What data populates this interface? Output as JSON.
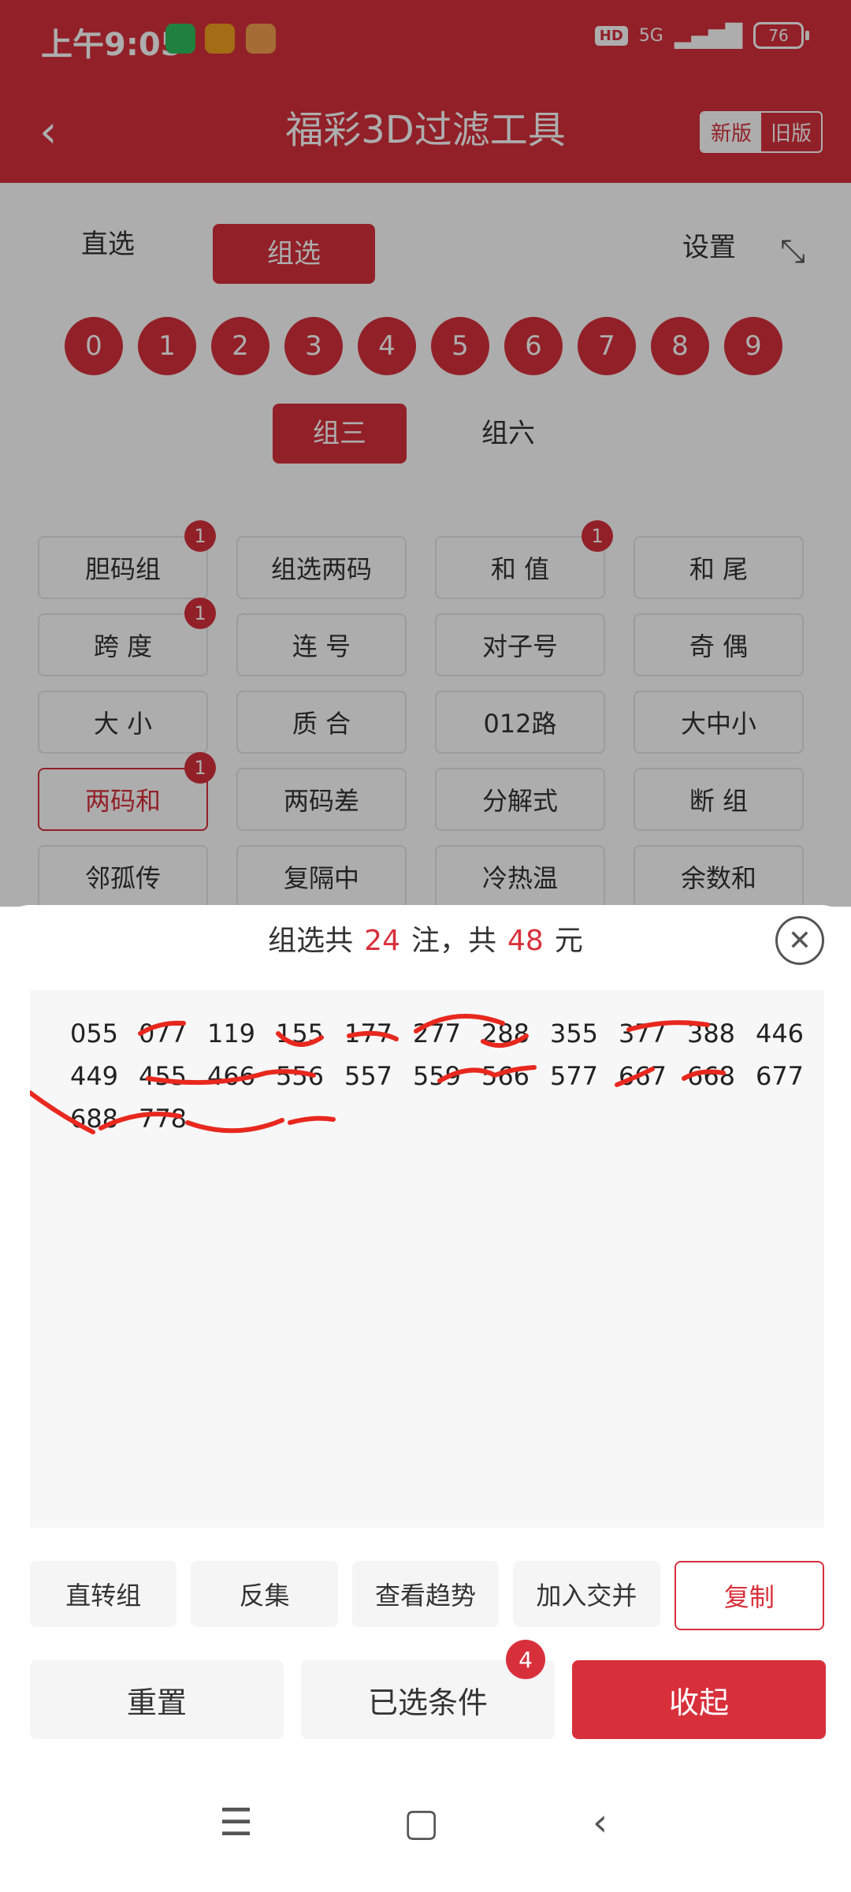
{
  "status": {
    "time": "上午9:05",
    "hd": "HD",
    "network": "5G",
    "battery": "76"
  },
  "header": {
    "title": "福彩3D过滤工具",
    "version_new": "新版",
    "version_old": "旧版"
  },
  "tabs": {
    "direct": "直选",
    "group": "组选",
    "settings": "设置"
  },
  "digits": [
    "0",
    "1",
    "2",
    "3",
    "4",
    "5",
    "6",
    "7",
    "8",
    "9"
  ],
  "subtabs": {
    "group3": "组三",
    "group6": "组六"
  },
  "conditions": [
    {
      "label": "胆码组",
      "badge": "1"
    },
    {
      "label": "组选两码",
      "badge": ""
    },
    {
      "label": "和 值",
      "badge": "1"
    },
    {
      "label": "和 尾",
      "badge": ""
    },
    {
      "label": "跨 度",
      "badge": "1"
    },
    {
      "label": "连 号",
      "badge": ""
    },
    {
      "label": "对子号",
      "badge": ""
    },
    {
      "label": "奇 偶",
      "badge": ""
    },
    {
      "label": "大 小",
      "badge": ""
    },
    {
      "label": "质 合",
      "badge": ""
    },
    {
      "label": "012路",
      "badge": ""
    },
    {
      "label": "大中小",
      "badge": ""
    },
    {
      "label": "两码和",
      "badge": "1"
    },
    {
      "label": "两码差",
      "badge": ""
    },
    {
      "label": "分解式",
      "badge": ""
    },
    {
      "label": "断 组",
      "badge": ""
    },
    {
      "label": "邻孤传",
      "badge": ""
    },
    {
      "label": "复隔中",
      "badge": ""
    },
    {
      "label": "冷热温",
      "badge": ""
    },
    {
      "label": "余数和",
      "badge": ""
    }
  ],
  "sheet": {
    "prefix": "组选共",
    "count": "24",
    "mid": "注，共",
    "amount": "48",
    "suffix": "元",
    "numbers": [
      "055",
      "077",
      "119",
      "155",
      "177",
      "277",
      "288",
      "355",
      "377",
      "388",
      "446",
      "449",
      "455",
      "466",
      "556",
      "557",
      "559",
      "566",
      "577",
      "667",
      "668",
      "677",
      "688",
      "778"
    ]
  },
  "actions": {
    "to_group": "直转组",
    "inverse": "反集",
    "trend": "查看趋势",
    "add_cross": "加入交并",
    "copy": "复制"
  },
  "bottom": {
    "reset": "重置",
    "selected": "已选条件",
    "selected_count": "4",
    "collapse": "收起"
  }
}
